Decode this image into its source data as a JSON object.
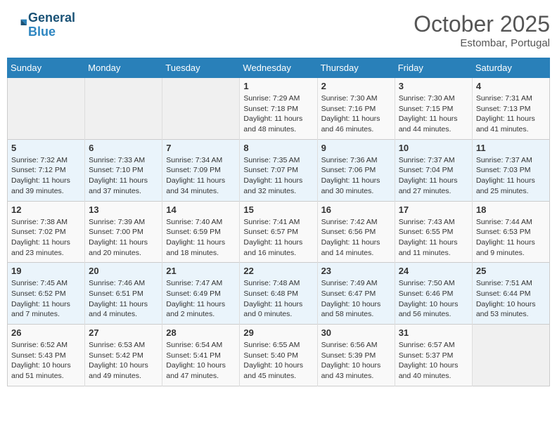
{
  "logo": {
    "line1": "General",
    "line2": "Blue"
  },
  "title": "October 2025",
  "subtitle": "Estombar, Portugal",
  "headers": [
    "Sunday",
    "Monday",
    "Tuesday",
    "Wednesday",
    "Thursday",
    "Friday",
    "Saturday"
  ],
  "weeks": [
    [
      {
        "day": "",
        "info": ""
      },
      {
        "day": "",
        "info": ""
      },
      {
        "day": "",
        "info": ""
      },
      {
        "day": "1",
        "info": "Sunrise: 7:29 AM\nSunset: 7:18 PM\nDaylight: 11 hours\nand 48 minutes."
      },
      {
        "day": "2",
        "info": "Sunrise: 7:30 AM\nSunset: 7:16 PM\nDaylight: 11 hours\nand 46 minutes."
      },
      {
        "day": "3",
        "info": "Sunrise: 7:30 AM\nSunset: 7:15 PM\nDaylight: 11 hours\nand 44 minutes."
      },
      {
        "day": "4",
        "info": "Sunrise: 7:31 AM\nSunset: 7:13 PM\nDaylight: 11 hours\nand 41 minutes."
      }
    ],
    [
      {
        "day": "5",
        "info": "Sunrise: 7:32 AM\nSunset: 7:12 PM\nDaylight: 11 hours\nand 39 minutes."
      },
      {
        "day": "6",
        "info": "Sunrise: 7:33 AM\nSunset: 7:10 PM\nDaylight: 11 hours\nand 37 minutes."
      },
      {
        "day": "7",
        "info": "Sunrise: 7:34 AM\nSunset: 7:09 PM\nDaylight: 11 hours\nand 34 minutes."
      },
      {
        "day": "8",
        "info": "Sunrise: 7:35 AM\nSunset: 7:07 PM\nDaylight: 11 hours\nand 32 minutes."
      },
      {
        "day": "9",
        "info": "Sunrise: 7:36 AM\nSunset: 7:06 PM\nDaylight: 11 hours\nand 30 minutes."
      },
      {
        "day": "10",
        "info": "Sunrise: 7:37 AM\nSunset: 7:04 PM\nDaylight: 11 hours\nand 27 minutes."
      },
      {
        "day": "11",
        "info": "Sunrise: 7:37 AM\nSunset: 7:03 PM\nDaylight: 11 hours\nand 25 minutes."
      }
    ],
    [
      {
        "day": "12",
        "info": "Sunrise: 7:38 AM\nSunset: 7:02 PM\nDaylight: 11 hours\nand 23 minutes."
      },
      {
        "day": "13",
        "info": "Sunrise: 7:39 AM\nSunset: 7:00 PM\nDaylight: 11 hours\nand 20 minutes."
      },
      {
        "day": "14",
        "info": "Sunrise: 7:40 AM\nSunset: 6:59 PM\nDaylight: 11 hours\nand 18 minutes."
      },
      {
        "day": "15",
        "info": "Sunrise: 7:41 AM\nSunset: 6:57 PM\nDaylight: 11 hours\nand 16 minutes."
      },
      {
        "day": "16",
        "info": "Sunrise: 7:42 AM\nSunset: 6:56 PM\nDaylight: 11 hours\nand 14 minutes."
      },
      {
        "day": "17",
        "info": "Sunrise: 7:43 AM\nSunset: 6:55 PM\nDaylight: 11 hours\nand 11 minutes."
      },
      {
        "day": "18",
        "info": "Sunrise: 7:44 AM\nSunset: 6:53 PM\nDaylight: 11 hours\nand 9 minutes."
      }
    ],
    [
      {
        "day": "19",
        "info": "Sunrise: 7:45 AM\nSunset: 6:52 PM\nDaylight: 11 hours\nand 7 minutes."
      },
      {
        "day": "20",
        "info": "Sunrise: 7:46 AM\nSunset: 6:51 PM\nDaylight: 11 hours\nand 4 minutes."
      },
      {
        "day": "21",
        "info": "Sunrise: 7:47 AM\nSunset: 6:49 PM\nDaylight: 11 hours\nand 2 minutes."
      },
      {
        "day": "22",
        "info": "Sunrise: 7:48 AM\nSunset: 6:48 PM\nDaylight: 11 hours\nand 0 minutes."
      },
      {
        "day": "23",
        "info": "Sunrise: 7:49 AM\nSunset: 6:47 PM\nDaylight: 10 hours\nand 58 minutes."
      },
      {
        "day": "24",
        "info": "Sunrise: 7:50 AM\nSunset: 6:46 PM\nDaylight: 10 hours\nand 56 minutes."
      },
      {
        "day": "25",
        "info": "Sunrise: 7:51 AM\nSunset: 6:44 PM\nDaylight: 10 hours\nand 53 minutes."
      }
    ],
    [
      {
        "day": "26",
        "info": "Sunrise: 6:52 AM\nSunset: 5:43 PM\nDaylight: 10 hours\nand 51 minutes."
      },
      {
        "day": "27",
        "info": "Sunrise: 6:53 AM\nSunset: 5:42 PM\nDaylight: 10 hours\nand 49 minutes."
      },
      {
        "day": "28",
        "info": "Sunrise: 6:54 AM\nSunset: 5:41 PM\nDaylight: 10 hours\nand 47 minutes."
      },
      {
        "day": "29",
        "info": "Sunrise: 6:55 AM\nSunset: 5:40 PM\nDaylight: 10 hours\nand 45 minutes."
      },
      {
        "day": "30",
        "info": "Sunrise: 6:56 AM\nSunset: 5:39 PM\nDaylight: 10 hours\nand 43 minutes."
      },
      {
        "day": "31",
        "info": "Sunrise: 6:57 AM\nSunset: 5:37 PM\nDaylight: 10 hours\nand 40 minutes."
      },
      {
        "day": "",
        "info": ""
      }
    ]
  ]
}
